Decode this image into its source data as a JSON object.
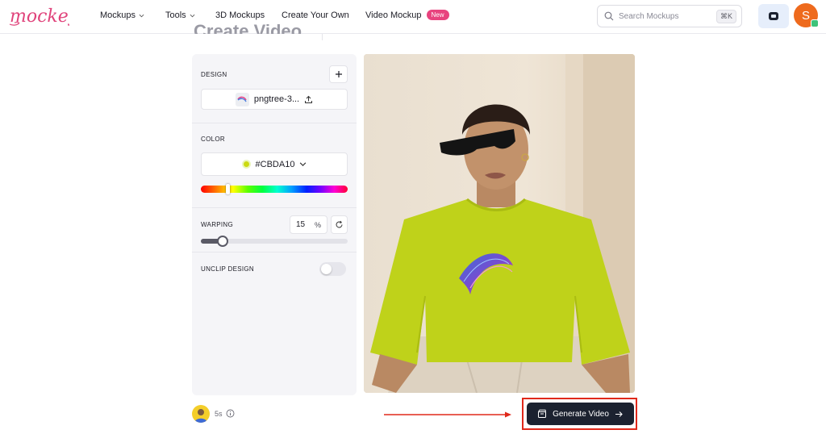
{
  "brand": {
    "logo_text": "mockey",
    "accent": "#e0437b"
  },
  "nav": {
    "items": [
      {
        "label": "Mockups",
        "has_dropdown": true
      },
      {
        "label": "Tools",
        "has_dropdown": true
      },
      {
        "label": "3D Mockups",
        "has_dropdown": false
      },
      {
        "label": "Create Your Own",
        "has_dropdown": false
      },
      {
        "label": "Video Mockup",
        "has_dropdown": false,
        "badge": "New"
      }
    ],
    "search": {
      "placeholder": "Search Mockups",
      "shortcut": "⌘K"
    },
    "avatar_initial": "S"
  },
  "page": {
    "title": "Create Video"
  },
  "design_panel": {
    "design": {
      "label": "DESIGN",
      "file_name": "pngtree-3..."
    },
    "color": {
      "label": "COLOR",
      "hex": "#CBDA10",
      "hue_position": 0.18
    },
    "warping": {
      "label": "WARPING",
      "value": "15",
      "unit": "%",
      "fraction": 0.15
    },
    "unclip": {
      "label": "UNCLIP DESIGN",
      "enabled": false
    }
  },
  "footer": {
    "duration": "5s",
    "generate_button": "Generate Video",
    "highlight_color": "#e0281a"
  },
  "colors": {
    "button_dark": "#1c2230",
    "panel_bg": "#f5f5f8"
  }
}
